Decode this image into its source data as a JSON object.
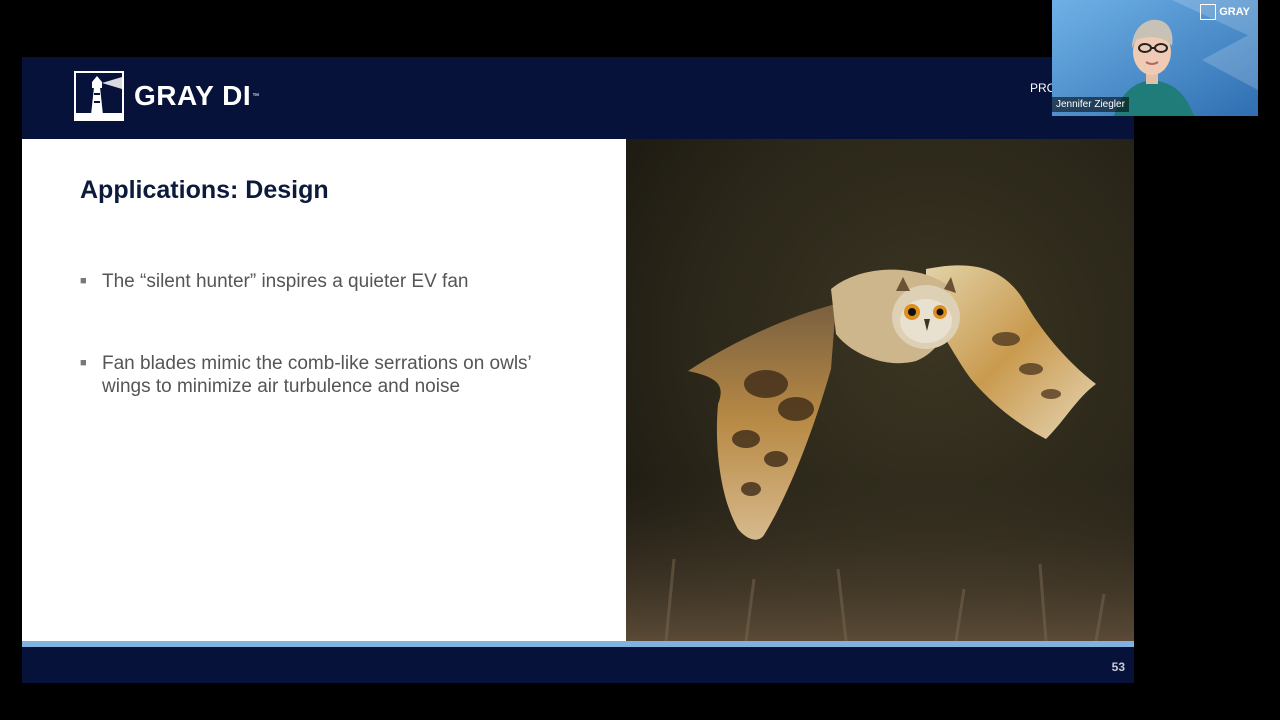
{
  "slide": {
    "logo_text": "GRAY DI",
    "logo_tm": "™",
    "header_right_text": "PRC",
    "title": "Applications:  Design",
    "bullets": [
      "The “silent hunter” inspires a quieter EV fan",
      "Fan blades mimic the comb-like serrations on owls’ wings to minimize air turbulence and noise"
    ],
    "page_number": "53"
  },
  "webcam": {
    "participant_name": "Jennifer Ziegler",
    "brand_text": "GRAY"
  },
  "colors": {
    "header_navy": "#06123a",
    "footer_accent": "#7fb2e0",
    "title_navy": "#0c1a3c",
    "webcam_blue": "#4f95d4"
  },
  "icons": [
    "lighthouse-logo-icon",
    "owl-photo"
  ]
}
